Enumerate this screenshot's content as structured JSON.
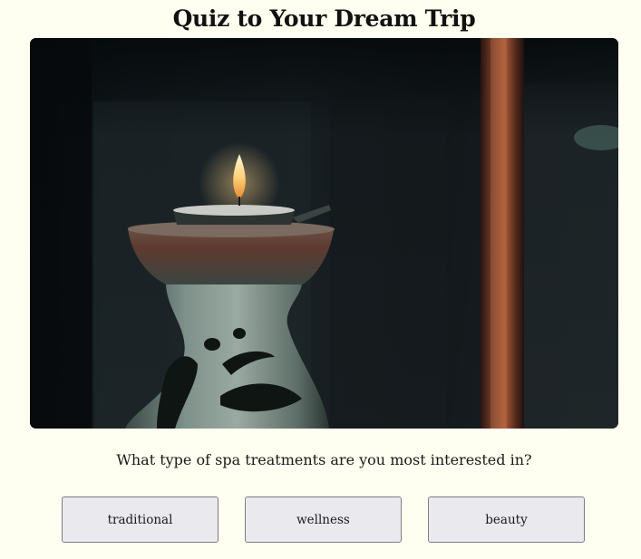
{
  "quiz": {
    "title": "Quiz to Your Dream Trip",
    "question": "What type of spa treatments are you most interested in?",
    "answers": [
      "traditional",
      "wellness",
      "beauty"
    ]
  },
  "hero_image": {
    "subject": "aroma-oil-burner-with-candle-photo"
  },
  "colors": {
    "background": "#fefff0",
    "button_bg": "#e9e9ee",
    "button_border": "#7d7d84"
  }
}
